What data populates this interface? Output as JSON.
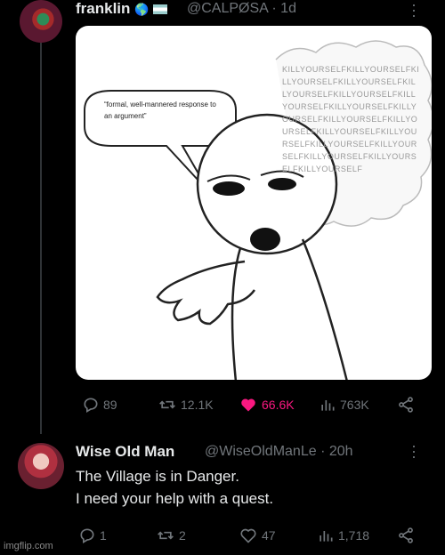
{
  "tweet1": {
    "display_name": "franklin",
    "handle_time": "@CALPØSA · 1d",
    "image": {
      "speech_bubble": "“formal, well-mannered response to an argument”",
      "thought_text": "KILLYOURSELFKILLYOURSELFKILLYOURSELF"
    },
    "actions": {
      "replies": "89",
      "retweets": "12.1K",
      "likes": "66.6K",
      "views": "763K"
    }
  },
  "tweet2": {
    "display_name": "Wise Old Man",
    "handle_time": "@WiseOldManLe · 20h",
    "line1": "The Village is in Danger.",
    "line2": "I need your help with a quest.",
    "actions": {
      "replies": "1",
      "retweets": "2",
      "likes": "47",
      "views": "1,718"
    }
  },
  "watermark": "imgflip.com",
  "colors": {
    "like": "#f91880",
    "muted": "#71767b",
    "text": "#e7e9ea"
  }
}
